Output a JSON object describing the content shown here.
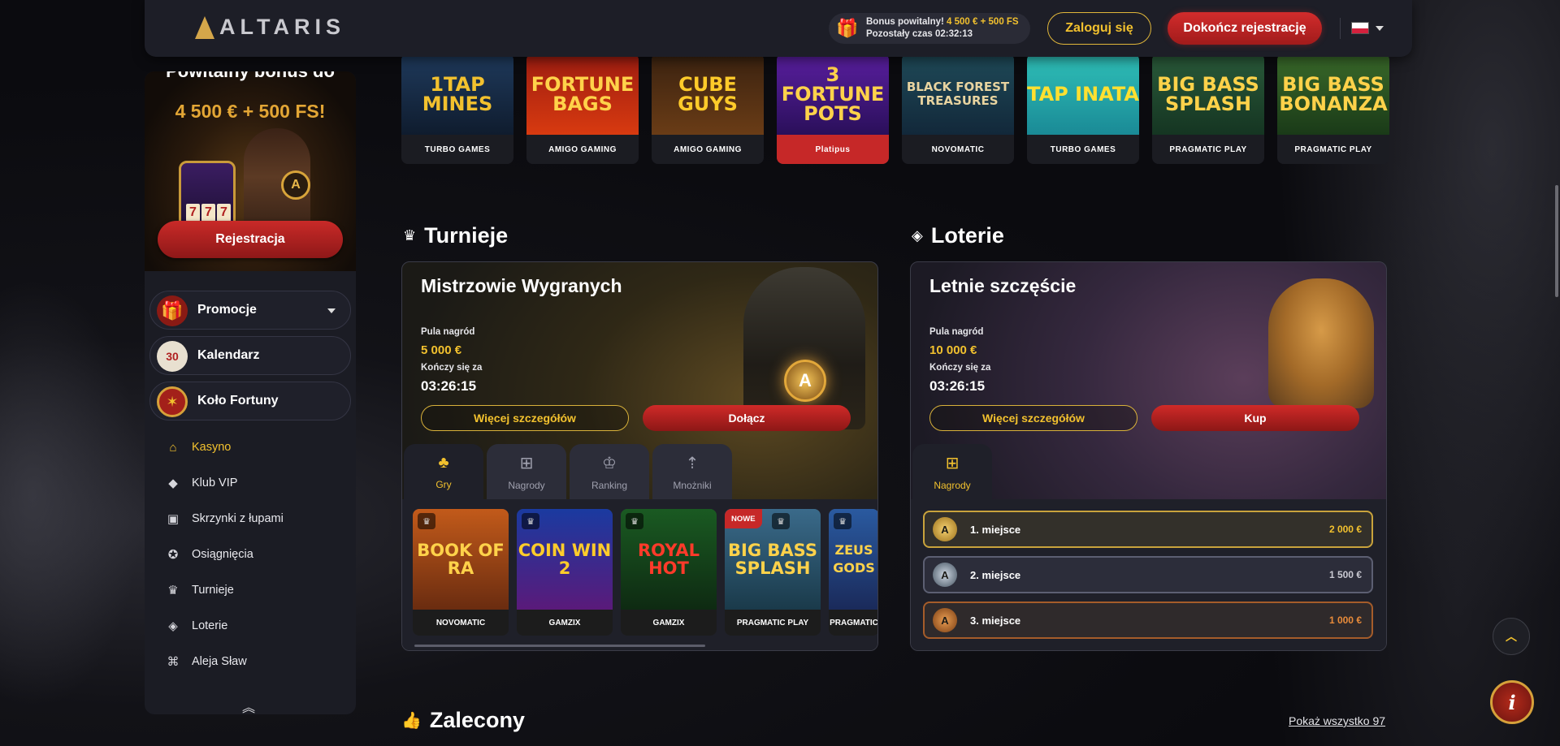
{
  "header": {
    "logo_text": "ALTARIS",
    "bonus_line1": "Bonus powitalny!",
    "bonus_amount": "4 500 € + 500 FS",
    "bonus_timer": "Pozostały czas 02:32:13",
    "login_label": "Zaloguj się",
    "finish_reg_label": "Dokończ rejestrację",
    "language": "PL"
  },
  "sidebar": {
    "promo": {
      "title": "Powitalny bonus do",
      "amount": "4 500 € + 500 FS!",
      "register_label": "Rejestracja",
      "slot_reels": [
        "7",
        "7",
        "7"
      ]
    },
    "pills": [
      {
        "label": "Promocje",
        "icon": "gift-icon",
        "has_dropdown": true
      },
      {
        "label": "Kalendarz",
        "icon": "calendar-icon"
      },
      {
        "label": "Koło Fortuny",
        "icon": "fortune-wheel-icon"
      }
    ],
    "nav": [
      {
        "label": "Kasyno",
        "icon": "home-icon",
        "active": true
      },
      {
        "label": "Klub VIP",
        "icon": "diamond-icon"
      },
      {
        "label": "Skrzynki z łupami",
        "icon": "loot-box-icon"
      },
      {
        "label": "Osiągnięcia",
        "icon": "achievement-icon"
      },
      {
        "label": "Turnieje",
        "icon": "trophy-icon"
      },
      {
        "label": "Loterie",
        "icon": "lottery-icon"
      },
      {
        "label": "Aleja Sław",
        "icon": "hall-of-fame-icon"
      }
    ]
  },
  "game_strip": [
    {
      "title": "1TAP MINES",
      "provider": "TURBO GAMES"
    },
    {
      "title": "FORTUNE BAGS",
      "provider": "AMIGO GAMING"
    },
    {
      "title": "CUBE GUYS",
      "provider": "AMIGO GAMING"
    },
    {
      "title": "3 FORTUNE POTS",
      "provider": "Platipus"
    },
    {
      "title": "BLACK FOREST TREASURES",
      "provider": "NOVOMATIC"
    },
    {
      "title": "TAP INATA",
      "provider": "TURBO GAMES"
    },
    {
      "title": "BIG BASS SPLASH",
      "provider": "PRAGMATIC PLAY"
    },
    {
      "title": "BIG BASS BONANZA",
      "provider": "PRAGMATIC PLAY"
    }
  ],
  "tournaments": {
    "section_title": "Turnieje",
    "name": "Mistrzowie Wygranych",
    "pool_label": "Pula nagród",
    "pool_value": "5 000 €",
    "ends_label": "Kończy się za",
    "ends_value": "03:26:15",
    "details_label": "Więcej szczegółów",
    "join_label": "Dołącz",
    "tabs": [
      {
        "label": "Gry",
        "icon": "cherries-icon",
        "active": true
      },
      {
        "label": "Nagrody",
        "icon": "gift-icon"
      },
      {
        "label": "Ranking",
        "icon": "crown-icon"
      },
      {
        "label": "Mnożniki",
        "icon": "multiplier-icon"
      }
    ],
    "games": [
      {
        "title": "BOOK OF RA",
        "provider": "NOVOMATIC",
        "is_new": false
      },
      {
        "title": "COIN WIN 2",
        "provider": "GAMZIX",
        "is_new": false
      },
      {
        "title": "ROYAL HOT",
        "provider": "GAMZIX",
        "is_new": false
      },
      {
        "title": "BIG BASS SPLASH",
        "provider": "PRAGMATIC PLAY",
        "is_new": true,
        "badge": "NOWE"
      },
      {
        "title": "ZEUS GODS",
        "provider": "PRAGMATIC",
        "is_new": false
      }
    ]
  },
  "lotteries": {
    "section_title": "Loterie",
    "name": "Letnie szczęście",
    "pool_label": "Pula nagród",
    "pool_value": "10 000 €",
    "ends_label": "Kończy się za",
    "ends_value": "03:26:15",
    "details_label": "Więcej szczegółów",
    "buy_label": "Kup",
    "tabs": [
      {
        "label": "Nagrody",
        "icon": "gift-icon",
        "active": true
      }
    ],
    "prizes": [
      {
        "place": "1. miejsce",
        "amount": "2 000 €"
      },
      {
        "place": "2. miejsce",
        "amount": "1 500 €"
      },
      {
        "place": "3. miejsce",
        "amount": "1 000 €"
      }
    ]
  },
  "recommended": {
    "title": "Zalecony",
    "show_all": "Pokaż wszystko 97"
  }
}
